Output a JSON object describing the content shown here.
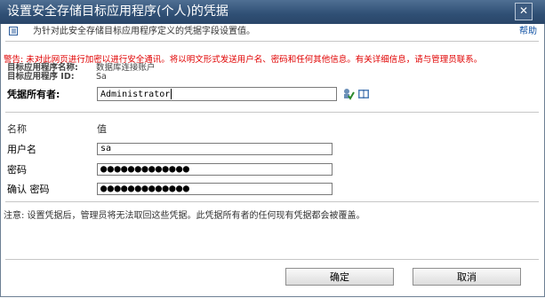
{
  "window": {
    "title": "设置安全存储目标应用程序(个人)的凭据",
    "close_glyph": "✕"
  },
  "info": {
    "description": "为针对此安全存储目标应用程序定义的凭据字段设置值。",
    "help": "帮助"
  },
  "warning": "警告: 未对此网页进行加密以进行安全通讯。将以明文形式发送用户名、密码和任何其他信息。有关详细信息，请与管理员联系。",
  "app": {
    "name_label": "目标应用程序名称:",
    "name_value": "数据库连接账户",
    "id_label": "目标应用程序 ID:",
    "id_value": "Sa"
  },
  "owner": {
    "label": "凭据所有者:",
    "value": "Administrator",
    "check_icon": "check-names-icon",
    "browse_icon": "address-book-icon"
  },
  "fields": {
    "header_name": "名称",
    "header_value": "值",
    "rows": [
      {
        "label": "用户名",
        "value": "sa"
      },
      {
        "label": "密码",
        "value": "●●●●●●●●●●●●●"
      },
      {
        "label": "确认 密码",
        "value": "●●●●●●●●●●●●●"
      }
    ]
  },
  "note": "注意: 设置凭据后，管理员将无法取回这些凭据。此凭据所有者的任何现有凭据都会被覆盖。",
  "buttons": {
    "ok": "确定",
    "cancel": "取消"
  },
  "colors": {
    "titlebar": "#2f4f74",
    "warning": "#e00000",
    "link": "#0b4ea2"
  }
}
